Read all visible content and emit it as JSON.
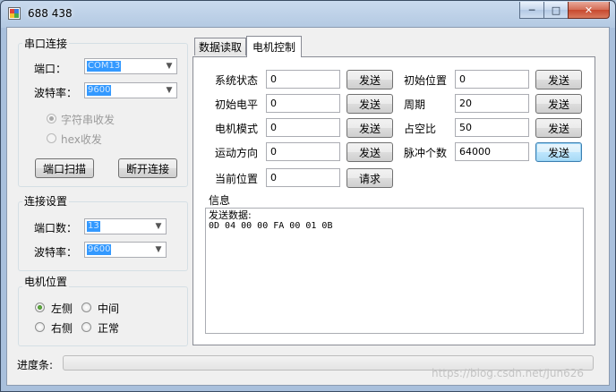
{
  "window": {
    "title": "688 438",
    "minimize_label": "─",
    "maximize_label": "□",
    "close_label": "✕"
  },
  "serial_group": {
    "title": "串口连接",
    "port_label": "端口：",
    "port_value": "COM13",
    "baud_label": "波特率：",
    "baud_value": "9600",
    "radio_char": "字符串收发",
    "radio_hex": "hex收发",
    "radio_char_checked": true,
    "scan_button": "端口扫描",
    "disconnect_button": "断开连接"
  },
  "connection_group": {
    "title": "连接设置",
    "port_count_label": "端口数：",
    "port_count_value": "13",
    "baud_label": "波特率：",
    "baud_value": "9600"
  },
  "motor_position_group": {
    "title": "电机位置",
    "options": [
      {
        "label": "左侧",
        "checked": true
      },
      {
        "label": "中间",
        "checked": false
      },
      {
        "label": "右侧",
        "checked": false
      },
      {
        "label": "正常",
        "checked": false
      }
    ]
  },
  "tabs": [
    {
      "label": "数据读取",
      "active": false
    },
    {
      "label": "电机控制",
      "active": true
    }
  ],
  "motor_control": {
    "left_fields": [
      {
        "label": "系统状态",
        "value": "0",
        "button": "发送"
      },
      {
        "label": "初始电平",
        "value": "0",
        "button": "发送"
      },
      {
        "label": "电机模式",
        "value": "0",
        "button": "发送"
      },
      {
        "label": "运动方向",
        "value": "0",
        "button": "发送"
      },
      {
        "label": "当前位置",
        "value": "0",
        "button": "请求"
      }
    ],
    "right_fields": [
      {
        "label": "初始位置",
        "value": "0",
        "button": "发送"
      },
      {
        "label": "周期",
        "value": "20",
        "button": "发送"
      },
      {
        "label": "占空比",
        "value": "50",
        "button": "发送"
      },
      {
        "label": "脉冲个数",
        "value": "64000",
        "button": "发送"
      }
    ],
    "info_title": "信息",
    "info_line1": "发送数据:",
    "info_line2": "0D 04 00 00 FA 00 01 0B"
  },
  "status": {
    "progress_label": "进度条:",
    "progress_fraction": 0
  },
  "watermark": "https://blog.csdn.net/Jun626"
}
